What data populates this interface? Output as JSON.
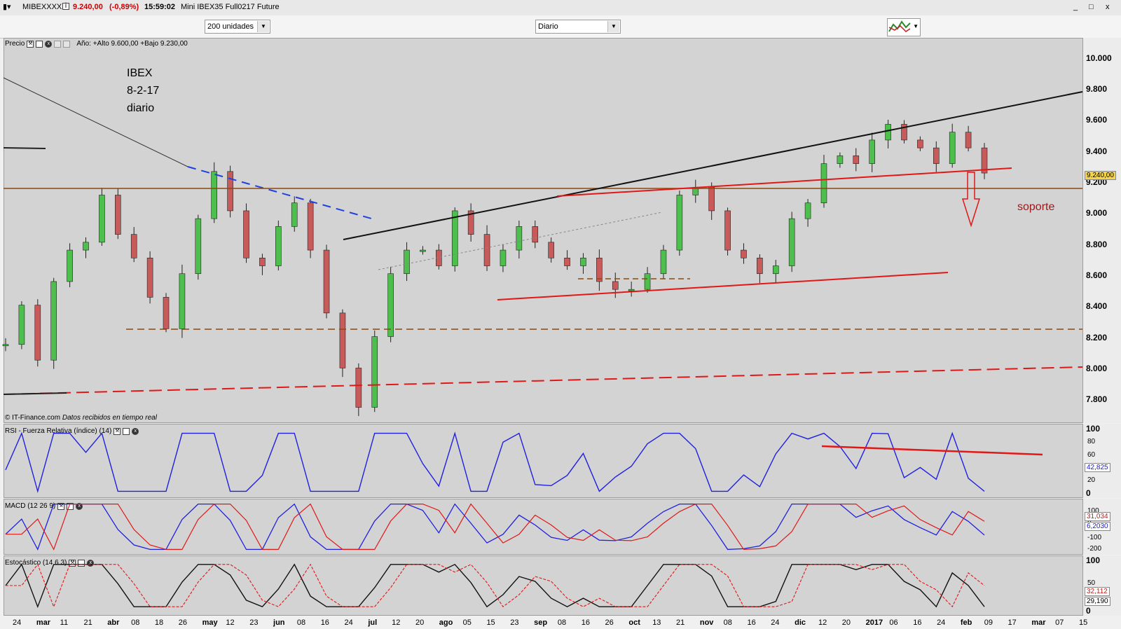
{
  "window": {
    "symbol": "MIBEXXXXX",
    "info_icon": "info-icon",
    "price": "9.240,00",
    "change": "(-0,89%)",
    "time": "15:59:02",
    "instrument": "Mini IBEX35 Full0217 Future",
    "minimize": "_",
    "restore": "□",
    "close": "x"
  },
  "toolbar": {
    "units": "200 unidades",
    "period": "Diario"
  },
  "colors": {
    "bg": "#d3d3d3",
    "up": "#4cbf4c",
    "down": "#c85a5a",
    "red": "#e01818",
    "blue": "#2020e0"
  },
  "price_pane": {
    "header_label": "Precio",
    "range_text": "Año: +Alto 9.600,00 +Bajo 9.230,00",
    "copyright": "© IT-Finance.com",
    "source": "Datos recibidos en tiempo real",
    "annotation_lines": [
      "IBEX",
      "8-2-17",
      "diario"
    ],
    "support_label": "soporte",
    "last_price": "9.240,00",
    "y_labels": [
      "10.000",
      "9.800",
      "9.600",
      "9.400",
      "9.200",
      "9.000",
      "8.800",
      "8.600",
      "8.400",
      "8.200",
      "8.000",
      "7.800"
    ]
  },
  "rsi_pane": {
    "header_label": "RSI - Fuerza Relativa (índice) (14)",
    "last_value": "42,825",
    "y_labels": [
      "100",
      "80",
      "60",
      "40",
      "20",
      "0"
    ]
  },
  "macd_pane": {
    "header_label": "MACD (12 26 9)",
    "macd_value": "31,034",
    "signal_value": "6,2030",
    "y_labels": [
      "100",
      "0",
      "-100",
      "-200"
    ]
  },
  "stoch_pane": {
    "header_label": "Estocástico (14 6 3)",
    "k_value": "32,112",
    "d_value": "29,190",
    "y_labels": [
      "100",
      "50",
      "0"
    ]
  },
  "x_axis": [
    {
      "t": "24",
      "b": false
    },
    {
      "t": "mar",
      "b": true
    },
    {
      "t": "11",
      "b": false
    },
    {
      "t": "21",
      "b": false
    },
    {
      "t": "abr",
      "b": true
    },
    {
      "t": "08",
      "b": false
    },
    {
      "t": "18",
      "b": false
    },
    {
      "t": "26",
      "b": false
    },
    {
      "t": "may",
      "b": true
    },
    {
      "t": "12",
      "b": false
    },
    {
      "t": "23",
      "b": false
    },
    {
      "t": "jun",
      "b": true
    },
    {
      "t": "08",
      "b": false
    },
    {
      "t": "16",
      "b": false
    },
    {
      "t": "24",
      "b": false
    },
    {
      "t": "jul",
      "b": true
    },
    {
      "t": "12",
      "b": false
    },
    {
      "t": "20",
      "b": false
    },
    {
      "t": "ago",
      "b": true
    },
    {
      "t": "05",
      "b": false
    },
    {
      "t": "15",
      "b": false
    },
    {
      "t": "23",
      "b": false
    },
    {
      "t": "sep",
      "b": true
    },
    {
      "t": "08",
      "b": false
    },
    {
      "t": "16",
      "b": false
    },
    {
      "t": "26",
      "b": false
    },
    {
      "t": "oct",
      "b": true
    },
    {
      "t": "13",
      "b": false
    },
    {
      "t": "21",
      "b": false
    },
    {
      "t": "nov",
      "b": true
    },
    {
      "t": "08",
      "b": false
    },
    {
      "t": "16",
      "b": false
    },
    {
      "t": "24",
      "b": false
    },
    {
      "t": "dic",
      "b": true
    },
    {
      "t": "12",
      "b": false
    },
    {
      "t": "20",
      "b": false
    },
    {
      "t": "2017",
      "b": true
    },
    {
      "t": "06",
      "b": false
    },
    {
      "t": "16",
      "b": false
    },
    {
      "t": "24",
      "b": false
    },
    {
      "t": "feb",
      "b": true
    },
    {
      "t": "09",
      "b": false
    },
    {
      "t": "17",
      "b": false
    },
    {
      "t": "mar",
      "b": true
    },
    {
      "t": "07",
      "b": false
    },
    {
      "t": "15",
      "b": false
    }
  ],
  "chart_data": {
    "type": "line",
    "ylim": [
      7650,
      10100
    ],
    "series": [
      {
        "values": [
          8150,
          8400,
          8050,
          8550,
          8750,
          8800,
          9100,
          8850,
          8700,
          8450,
          8250,
          8600,
          8950,
          9250,
          9000,
          8700,
          8650,
          8900,
          9050,
          8750,
          8350,
          8000,
          7750,
          8200,
          8600,
          8750,
          8750,
          8650,
          9000,
          8850,
          8650,
          8750,
          8900,
          8800,
          8700,
          8650,
          8700,
          8550,
          8500,
          8500,
          8600,
          8750,
          9100,
          9150,
          9000,
          8750,
          8700,
          8600,
          8650,
          8950,
          9050,
          9300,
          9350,
          9300,
          9450,
          9550,
          9450,
          9400,
          9300,
          9500,
          9400,
          9240
        ]
      }
    ]
  }
}
